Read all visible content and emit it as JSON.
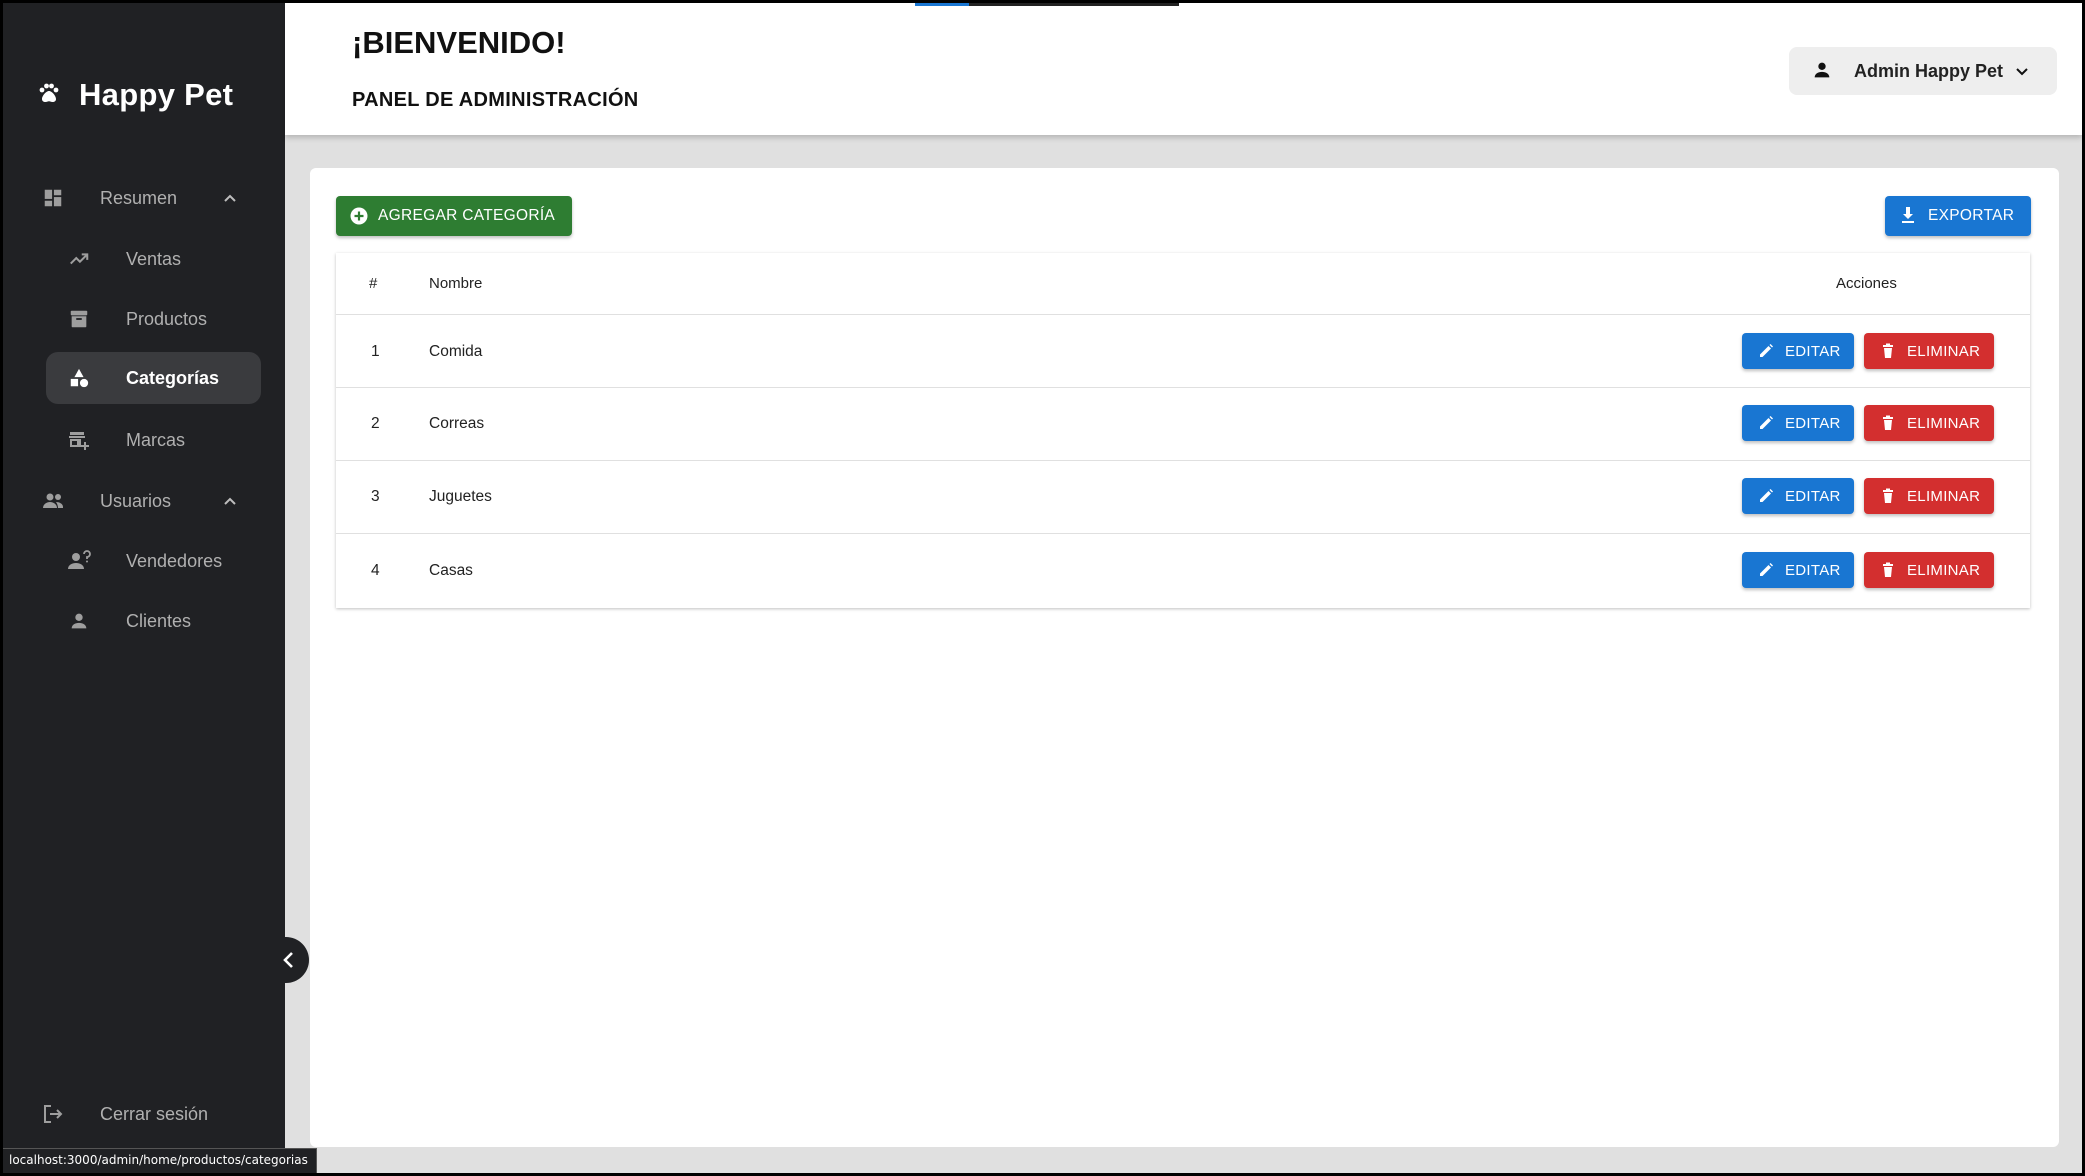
{
  "brand": {
    "title": "Happy Pet",
    "icon": "paw-icon"
  },
  "sidebar": {
    "items": [
      {
        "label": "Resumen",
        "icon": "dashboard-icon",
        "type": "group"
      },
      {
        "label": "Ventas",
        "icon": "trending-up-icon",
        "type": "item"
      },
      {
        "label": "Productos",
        "icon": "archive-icon",
        "type": "item"
      },
      {
        "label": "Categorías",
        "icon": "category-icon",
        "type": "item",
        "active": true
      },
      {
        "label": "Marcas",
        "icon": "add-business-icon",
        "type": "item"
      },
      {
        "label": "Usuarios",
        "icon": "people-icon",
        "type": "group"
      },
      {
        "label": "Vendedores",
        "icon": "person-badge-icon",
        "type": "item"
      },
      {
        "label": "Clientes",
        "icon": "person-icon",
        "type": "item"
      }
    ],
    "logout_label": "Cerrar sesión"
  },
  "header": {
    "title": "¡BIENVENIDO!",
    "subtitle": "PANEL DE ADMINISTRACIÓN",
    "user_label": "Admin Happy Pet"
  },
  "toolbar": {
    "add_label": "AGREGAR CATEGORÍA",
    "export_label": "EXPORTAR"
  },
  "table": {
    "columns": {
      "num": "#",
      "name": "Nombre",
      "actions": "Acciones"
    },
    "rows": [
      {
        "num": "1",
        "name": "Comida"
      },
      {
        "num": "2",
        "name": "Correas"
      },
      {
        "num": "3",
        "name": "Juguetes"
      },
      {
        "num": "4",
        "name": "Casas"
      }
    ],
    "edit_label": "EDITAR",
    "delete_label": "ELIMINAR"
  },
  "status_url": "localhost:3000/admin/home/productos/categorias",
  "colors": {
    "sidebar_bg": "#202124",
    "accent_blue": "#1976d2",
    "success_green": "#2e7d32",
    "danger_red": "#d32f2f"
  }
}
